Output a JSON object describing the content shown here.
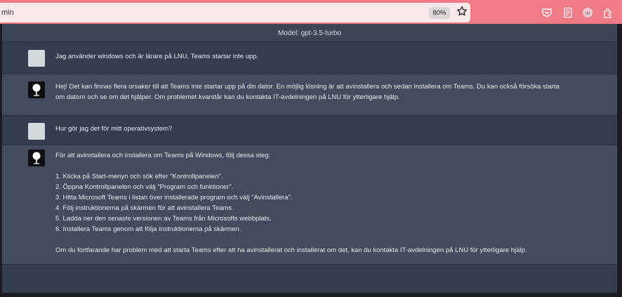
{
  "browser": {
    "url_fragment": "min",
    "zoom": "80%",
    "icons": [
      "star-icon",
      "pocket-icon",
      "reader-view-icon",
      "account-icon",
      "extensions-icon"
    ]
  },
  "chat": {
    "model_label": "Model: gpt-3.5-turbo",
    "messages": [
      {
        "role": "user",
        "lines": [
          "Jag använder windows och är lärare på LNU, Teams startar inte upp."
        ]
      },
      {
        "role": "assistant",
        "lines": [
          "Hej! Det kan finnas flera orsaker till att Teams inte startar upp på din dator. En möjlig lösning är att avinstallera och sedan installera om Teams. Du kan också försöka starta",
          "om datorn och se om det hjälper. Om problemet kvarstår kan du kontakta IT-avdelningen på LNU för ytterligare hjälp."
        ]
      },
      {
        "role": "user",
        "lines": [
          "Hur gör jag det för mitt operativsystem?"
        ]
      },
      {
        "role": "assistant",
        "intro": "För att avinstallera och installera om Teams på Windows, följ dessa steg:",
        "steps": [
          "1. Klicka på Start-menyn och sök efter \"Kontrollpanelen\".",
          "2. Öppna Kontrollpanelen och välj \"Program och funktioner\".",
          "3. Hitta Microsoft Teams i listan över installerade program och välj \"Avinstallera\".",
          "4. Följ instruktionerna på skärmen för att avinstallera Teams.",
          "5. Ladda ner den senaste versionen av Teams från Microsofts webbplats.",
          "6. Installera Teams genom att följa instruktionerna på skärmen."
        ],
        "outro": "Om du fortfarande har problem med att starta Teams efter att ha avinstallerat och installerat om det, kan du kontakta IT-avdelningen på LNU för ytterligare hjälp."
      }
    ]
  },
  "colors": {
    "toolbar": "#f07a85",
    "chat_bg": "#343d4f",
    "assistant_bg": "#434c5e"
  }
}
